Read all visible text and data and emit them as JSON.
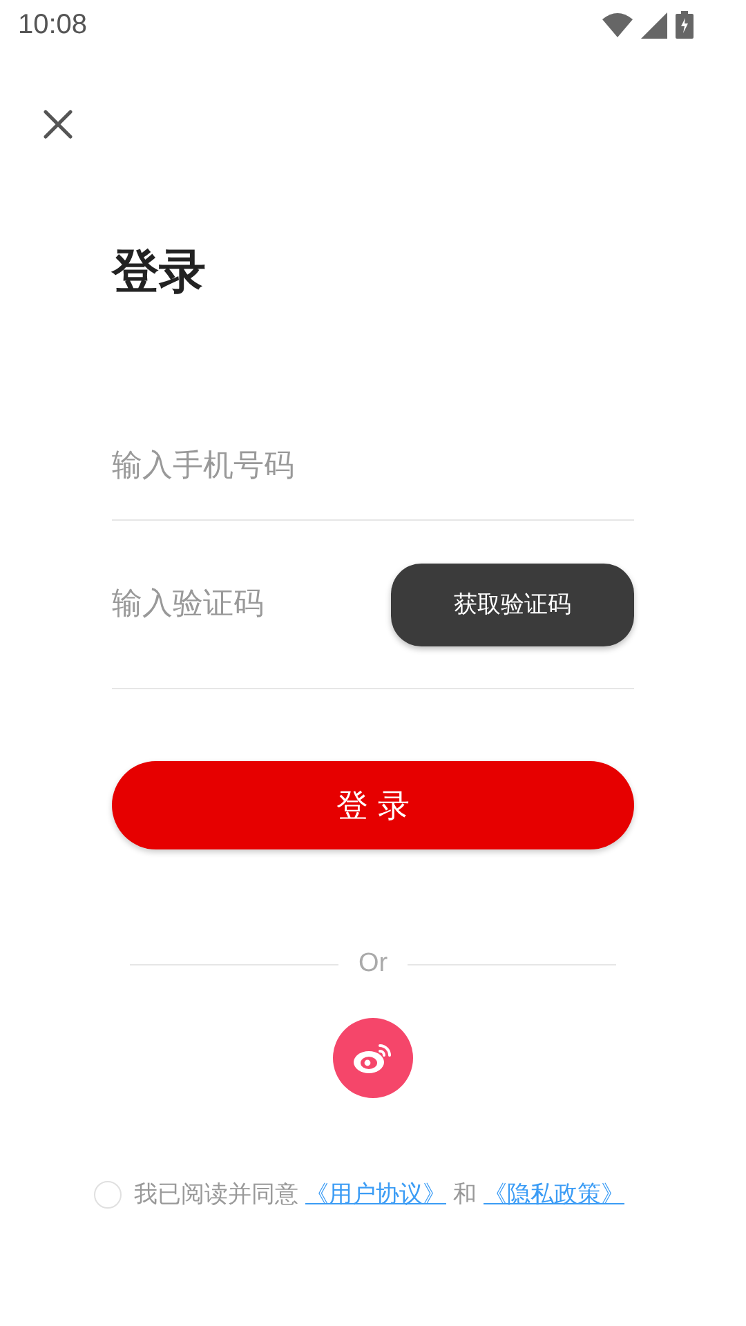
{
  "status_bar": {
    "time": "10:08"
  },
  "title": "登录",
  "phone_field": {
    "placeholder": "输入手机号码"
  },
  "code_field": {
    "placeholder": "输入验证码"
  },
  "get_code_button": "获取验证码",
  "login_button": "登 录",
  "divider_text": "Or",
  "agreement": {
    "checked": false,
    "text": "我已阅读并同意",
    "user_agreement": "《用户协议》",
    "conjunction": "和",
    "privacy_policy": "《隐私政策》"
  }
}
